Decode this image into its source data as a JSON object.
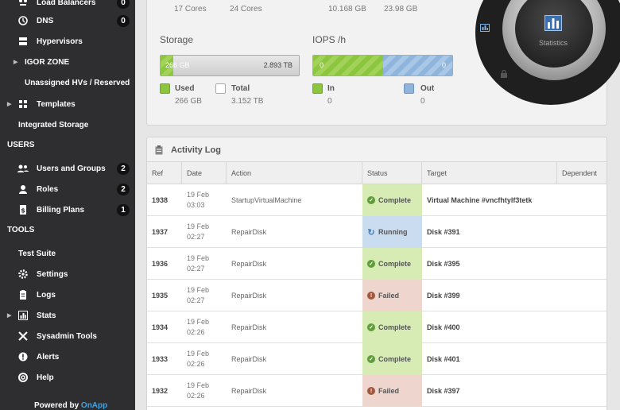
{
  "sidebar": {
    "items": [
      {
        "label": "Load Balancers",
        "badge": "0",
        "icon": "load-balancer-icon"
      },
      {
        "label": "DNS",
        "badge": "0",
        "icon": "dns-icon"
      },
      {
        "label": "Hypervisors",
        "icon": "hypervisor-icon"
      },
      {
        "label": "IGOR ZONE",
        "icon": "arrow-right-icon"
      },
      {
        "label": "Unassigned HVs / Reserved"
      },
      {
        "label": "Templates",
        "icon": "templates-icon"
      },
      {
        "label": "Integrated Storage"
      }
    ],
    "users_heading": "USERS",
    "users_items": [
      {
        "label": "Users and Groups",
        "badge": "2",
        "icon": "users-icon"
      },
      {
        "label": "Roles",
        "badge": "2",
        "icon": "roles-icon"
      },
      {
        "label": "Billing Plans",
        "badge": "1",
        "icon": "billing-icon"
      }
    ],
    "tools_heading": "TOOLS",
    "tools_items": [
      {
        "label": "Test Suite"
      },
      {
        "label": "Settings",
        "icon": "gear-icon"
      },
      {
        "label": "Logs",
        "icon": "logs-icon"
      },
      {
        "label": "Stats",
        "icon": "stats-icon"
      },
      {
        "label": "Sysadmin Tools",
        "icon": "tools-icon"
      },
      {
        "label": "Alerts",
        "icon": "alert-icon"
      },
      {
        "label": "Help",
        "icon": "help-icon"
      }
    ],
    "powered_by": "Powered by",
    "brand": "OnApp"
  },
  "stats": {
    "cpu": {
      "used": "17 Cores",
      "total": "24 Cores"
    },
    "memory": {
      "used": "10.168 GB",
      "total": "23.98 GB"
    },
    "storage": {
      "title": "Storage",
      "bar_used": "266 GB",
      "bar_total": "2.893 TB",
      "fill_fraction": 0.09,
      "used_label": "Used",
      "used_value": "266 GB",
      "total_label": "Total",
      "total_value": "3.152 TB"
    },
    "iops": {
      "title": "IOPS /h",
      "bar_in": "0",
      "bar_out": "0",
      "in_fraction": 0.5,
      "in_label": "In",
      "in_value": "0",
      "out_label": "Out",
      "out_value": "0"
    }
  },
  "dial": {
    "label": "Statistics"
  },
  "activity_log": {
    "title": "Activity Log",
    "columns": [
      "Ref",
      "Date",
      "Action",
      "Status",
      "Target",
      "Dependent"
    ],
    "rows": [
      {
        "ref": "1938",
        "date": "19 Feb",
        "time": "03:03",
        "action": "StartupVirtualMachine",
        "status": "Complete",
        "target": "Virtual Machine #vncfhtylf3tetk"
      },
      {
        "ref": "1937",
        "date": "19 Feb",
        "time": "02:27",
        "action": "RepairDisk",
        "status": "Running",
        "target": "Disk #391"
      },
      {
        "ref": "1936",
        "date": "19 Feb",
        "time": "02:27",
        "action": "RepairDisk",
        "status": "Complete",
        "target": "Disk #395"
      },
      {
        "ref": "1935",
        "date": "19 Feb",
        "time": "02:27",
        "action": "RepairDisk",
        "status": "Failed",
        "target": "Disk #399"
      },
      {
        "ref": "1934",
        "date": "19 Feb",
        "time": "02:26",
        "action": "RepairDisk",
        "status": "Complete",
        "target": "Disk #400"
      },
      {
        "ref": "1933",
        "date": "19 Feb",
        "time": "02:26",
        "action": "RepairDisk",
        "status": "Complete",
        "target": "Disk #401"
      },
      {
        "ref": "1932",
        "date": "19 Feb",
        "time": "02:26",
        "action": "RepairDisk",
        "status": "Failed",
        "target": "Disk #397"
      }
    ]
  },
  "colors": {
    "sidebar_bg": "#2e2e30",
    "complete_bg": "#d6ecb4",
    "running_bg": "#c9dcf0",
    "failed_bg": "#eed6cf",
    "complete_icon": "#5f9c3a",
    "running_icon": "#4a7fb4",
    "failed_icon": "#a0573e",
    "brand": "#4aa0d8"
  }
}
